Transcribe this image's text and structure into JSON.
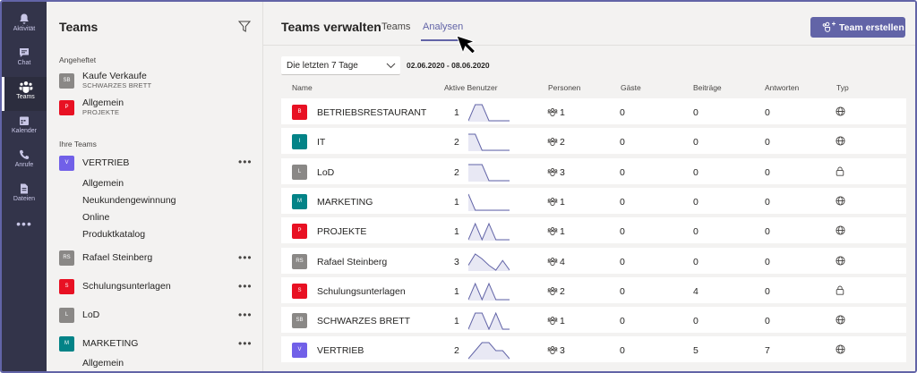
{
  "rail": {
    "items": [
      {
        "label": "Aktivität",
        "icon": "bell-icon"
      },
      {
        "label": "Chat",
        "icon": "chat-icon"
      },
      {
        "label": "Teams",
        "icon": "teams-icon"
      },
      {
        "label": "Kalender",
        "icon": "calendar-icon"
      },
      {
        "label": "Anrufe",
        "icon": "phone-icon"
      },
      {
        "label": "Dateien",
        "icon": "file-icon"
      }
    ],
    "more": "•••"
  },
  "sidebar": {
    "title": "Teams",
    "pinned_label": "Angeheftet",
    "pinned": [
      {
        "initials": "SB",
        "name": "Kaufe Verkaufe",
        "sub": "SCHWARZES BRETT",
        "color": "#8a8886"
      },
      {
        "initials": "P",
        "name": "Allgemein",
        "sub": "PROJEKTE",
        "color": "#e81123"
      }
    ],
    "your_teams_label": "Ihre Teams",
    "teams": [
      {
        "initials": "V",
        "name": "VERTRIEB",
        "color": "#7160e8",
        "more": "•••"
      },
      {
        "initials": "RS",
        "name": "Rafael Steinberg",
        "color": "#8a8886",
        "more": "•••"
      },
      {
        "initials": "S",
        "name": "Schulungsunterlagen",
        "color": "#e81123",
        "more": "•••"
      },
      {
        "initials": "L",
        "name": "LoD",
        "color": "#8a8886",
        "more": "•••"
      },
      {
        "initials": "M",
        "name": "MARKETING",
        "color": "#038387",
        "more": "•••"
      }
    ],
    "vertrieb_channels": [
      "Allgemein",
      "Neukundengewinnung",
      "Online",
      "Produktkatalog"
    ],
    "marketing_channels": [
      "Allgemein"
    ]
  },
  "main": {
    "title": "Teams verwalten",
    "tabs": [
      "Teams",
      "Analysen"
    ],
    "active_tab": "Analysen",
    "create_button": "Team erstellen",
    "range_select": "Die letzten 7 Tage",
    "range_text": "02.06.2020 - 08.06.2020",
    "columns": {
      "name": "Name",
      "active_users": "Aktive Benutzer",
      "people": "Personen",
      "guests": "Gäste",
      "posts": "Beiträge",
      "replies": "Antworten",
      "type": "Typ"
    },
    "rows": [
      {
        "initials": "B",
        "color": "#e81123",
        "name": "BETRIEBSRESTAURANT",
        "active": "1",
        "people": "1",
        "guests": "0",
        "posts": "0",
        "replies": "0",
        "type": "globe-icon",
        "spark": [
          0,
          1,
          1,
          0,
          0,
          0,
          0
        ]
      },
      {
        "initials": "I",
        "color": "#038387",
        "name": "IT",
        "active": "2",
        "people": "2",
        "guests": "0",
        "posts": "0",
        "replies": "0",
        "type": "globe-icon",
        "spark": [
          1,
          1,
          0,
          0,
          0,
          0,
          0
        ]
      },
      {
        "initials": "L",
        "color": "#8a8886",
        "name": "LoD",
        "active": "2",
        "people": "3",
        "guests": "0",
        "posts": "0",
        "replies": "0",
        "type": "lock-icon",
        "spark": [
          1,
          1,
          1,
          0,
          0,
          0,
          0
        ]
      },
      {
        "initials": "M",
        "color": "#038387",
        "name": "MARKETING",
        "active": "1",
        "people": "1",
        "guests": "0",
        "posts": "0",
        "replies": "0",
        "type": "globe-icon",
        "spark": [
          1,
          0,
          0,
          0,
          0,
          0,
          0
        ]
      },
      {
        "initials": "P",
        "color": "#e81123",
        "name": "PROJEKTE",
        "active": "1",
        "people": "1",
        "guests": "0",
        "posts": "0",
        "replies": "0",
        "type": "globe-icon",
        "spark": [
          0,
          1,
          0,
          1,
          0,
          0,
          0
        ]
      },
      {
        "initials": "RS",
        "color": "#8a8886",
        "name": "Rafael Steinberg",
        "active": "3",
        "people": "4",
        "guests": "0",
        "posts": "0",
        "replies": "0",
        "type": "globe-icon",
        "spark": [
          0.3,
          1,
          0.7,
          0.3,
          0,
          0.6,
          0
        ]
      },
      {
        "initials": "S",
        "color": "#e81123",
        "name": "Schulungsunterlagen",
        "active": "1",
        "people": "2",
        "guests": "0",
        "posts": "4",
        "replies": "0",
        "type": "lock-icon",
        "spark": [
          0,
          1,
          0,
          1,
          0,
          0,
          0
        ]
      },
      {
        "initials": "SB",
        "color": "#8a8886",
        "name": "SCHWARZES BRETT",
        "active": "1",
        "people": "1",
        "guests": "0",
        "posts": "0",
        "replies": "0",
        "type": "globe-icon",
        "spark": [
          0,
          1,
          1,
          0,
          1,
          0,
          0
        ]
      },
      {
        "initials": "V",
        "color": "#7160e8",
        "name": "VERTRIEB",
        "active": "2",
        "people": "3",
        "guests": "0",
        "posts": "5",
        "replies": "7",
        "type": "globe-icon",
        "spark": [
          0,
          0.5,
          1,
          1,
          0.5,
          0.5,
          0
        ]
      }
    ]
  },
  "colors": {
    "accent": "#6264a7",
    "rail": "#33344a"
  }
}
